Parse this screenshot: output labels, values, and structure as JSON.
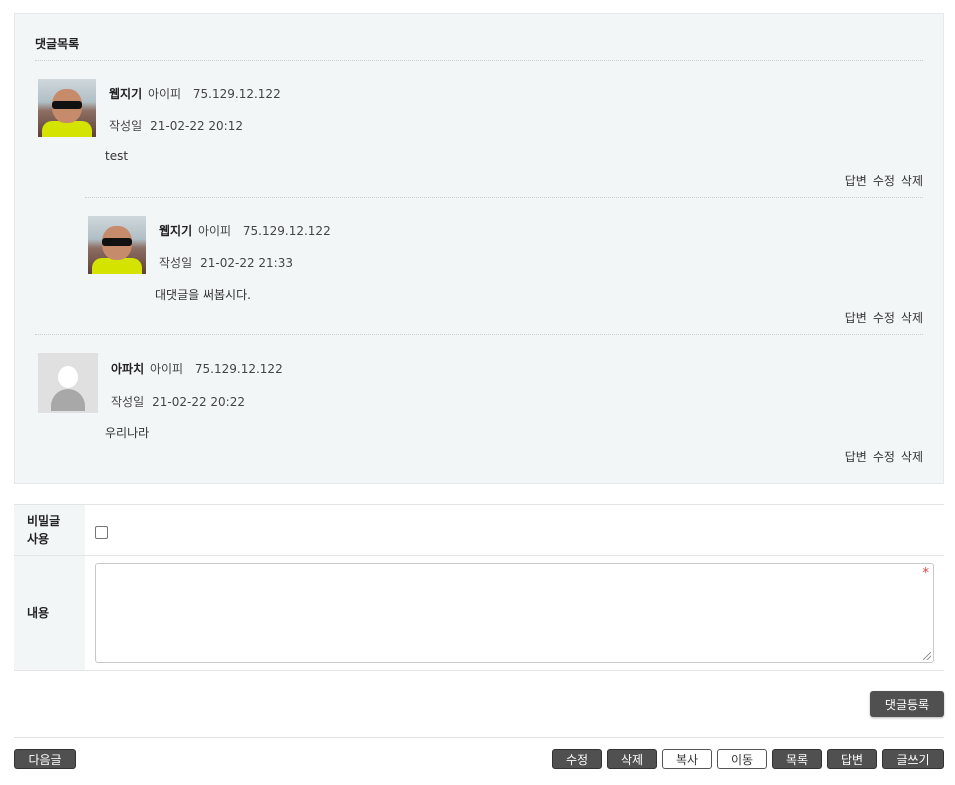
{
  "comments": {
    "title": "댓글목록",
    "items": [
      {
        "author": "웹지기",
        "ip_label": "아이피",
        "ip": "75.129.12.122",
        "date_label": "작성일",
        "date": "21-02-22 20:12",
        "text": "test",
        "avatar": "user-photo-icon"
      },
      {
        "author": "웹지기",
        "ip_label": "아이피",
        "ip": "75.129.12.122",
        "date_label": "작성일",
        "date": "21-02-22 21:33",
        "text": "대댓글을 써봅시다.",
        "avatar": "user-photo-icon"
      },
      {
        "author": "아파치",
        "ip_label": "아이피",
        "ip": "75.129.12.122",
        "date_label": "작성일",
        "date": "21-02-22 20:22",
        "text": "우리나라",
        "avatar": "default-user-icon"
      }
    ],
    "actions": {
      "reply": "답변",
      "edit": "수정",
      "delete": "삭제"
    }
  },
  "form": {
    "secret_label": "비밀글\n사용",
    "content_label": "내용",
    "content_value": "",
    "required_mark": "*",
    "submit_label": "댓글등록"
  },
  "nav": {
    "next": "다음글",
    "edit": "수정",
    "delete": "삭제",
    "copy": "복사",
    "move": "이동",
    "list": "목록",
    "reply": "답변",
    "write": "글쓰기"
  }
}
